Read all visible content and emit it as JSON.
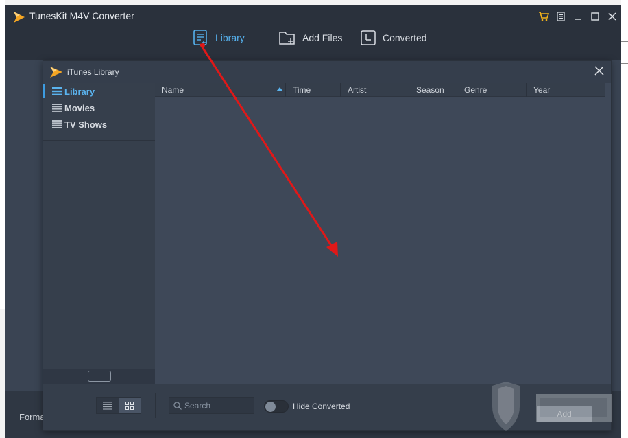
{
  "app": {
    "title": "TunesKit M4V Converter",
    "accent_color": "#55b0ec",
    "cart_color": "#f2b21a"
  },
  "window_controls": [
    {
      "name": "cart-icon",
      "glyph": "🛒"
    },
    {
      "name": "menu-icon",
      "glyph": "▤"
    },
    {
      "name": "minimize-icon",
      "glyph": "—"
    },
    {
      "name": "maximize-icon",
      "glyph": "☐"
    },
    {
      "name": "close-icon",
      "glyph": "✕"
    }
  ],
  "nav": {
    "library": "Library",
    "add_files": "Add Files",
    "converted": "Converted"
  },
  "dialog": {
    "title": "iTunes Library",
    "close_glyph": "✕"
  },
  "sidebar": {
    "items": [
      {
        "label": "Library",
        "active": true
      },
      {
        "label": "Movies",
        "active": false
      },
      {
        "label": "TV Shows",
        "active": false
      }
    ]
  },
  "table": {
    "columns": [
      "Name",
      "Time",
      "Artist",
      "Season",
      "Genre",
      "Year"
    ],
    "sorted_column": "Name",
    "sort_direction": "ascending",
    "rows": []
  },
  "footer": {
    "search_placeholder": "Search",
    "hide_converted_label": "Hide Converted",
    "hide_converted_on": false,
    "add_label": "Add"
  },
  "under_bar": {
    "format_label": "Forma"
  },
  "annotation": {
    "arrow_color": "#e01818"
  }
}
